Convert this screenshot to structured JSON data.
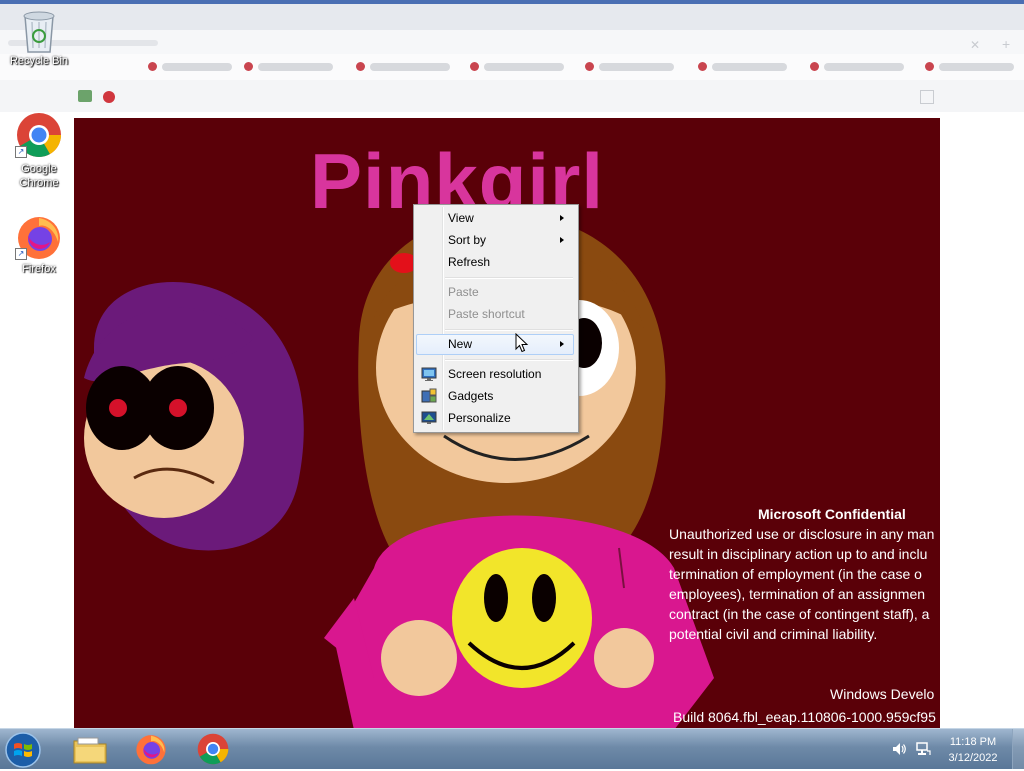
{
  "desktop": {
    "icons": [
      {
        "label": "Recycle Bin",
        "icon": "recycle-bin-icon"
      },
      {
        "label": "Google Chrome",
        "icon": "chrome-icon"
      },
      {
        "label": "Firefox",
        "icon": "firefox-icon"
      }
    ],
    "wallpaper_text": "Pinkgirl"
  },
  "watermark": {
    "title": "Microsoft Confidential",
    "lines": [
      "Unauthorized use or disclosure in any man",
      "result in disciplinary action up to and inclu",
      "termination of employment (in the case o",
      "employees), termination of an assignmen",
      "contract (in the case of contingent staff), a",
      "potential civil and criminal liability."
    ],
    "build_line1": "Windows Develo",
    "build_line2": "Build 8064.fbl_eeap.110806-1000.959cf95"
  },
  "context_menu": {
    "items": [
      {
        "label": "View",
        "submenu": true,
        "enabled": true
      },
      {
        "label": "Sort by",
        "submenu": true,
        "enabled": true
      },
      {
        "label": "Refresh",
        "submenu": false,
        "enabled": true
      },
      {
        "label": "Paste",
        "submenu": false,
        "enabled": false
      },
      {
        "label": "Paste shortcut",
        "submenu": false,
        "enabled": false
      },
      {
        "label": "New",
        "submenu": true,
        "enabled": true,
        "highlighted": true
      },
      {
        "label": "Screen resolution",
        "submenu": false,
        "enabled": true,
        "icon": "screen-resolution-icon"
      },
      {
        "label": "Gadgets",
        "submenu": false,
        "enabled": true,
        "icon": "gadgets-icon"
      },
      {
        "label": "Personalize",
        "submenu": false,
        "enabled": true,
        "icon": "personalize-icon"
      }
    ]
  },
  "taskbar": {
    "start": "start-orb-icon",
    "pinned": [
      {
        "name": "Windows Explorer",
        "icon": "file-explorer-icon"
      },
      {
        "name": "Firefox",
        "icon": "firefox-icon"
      },
      {
        "name": "Google Chrome",
        "icon": "chrome-icon"
      }
    ],
    "tray": {
      "volume_icon": "volume-icon",
      "network_icon": "network-icon",
      "time": "11:18 PM",
      "date": "3/12/2022"
    }
  },
  "colors": {
    "wallpaper_bg": "#5a0008",
    "title_pink": "#d8359d",
    "menu_bg": "#f0f0f0",
    "taskbar": "#6e8aa8"
  }
}
